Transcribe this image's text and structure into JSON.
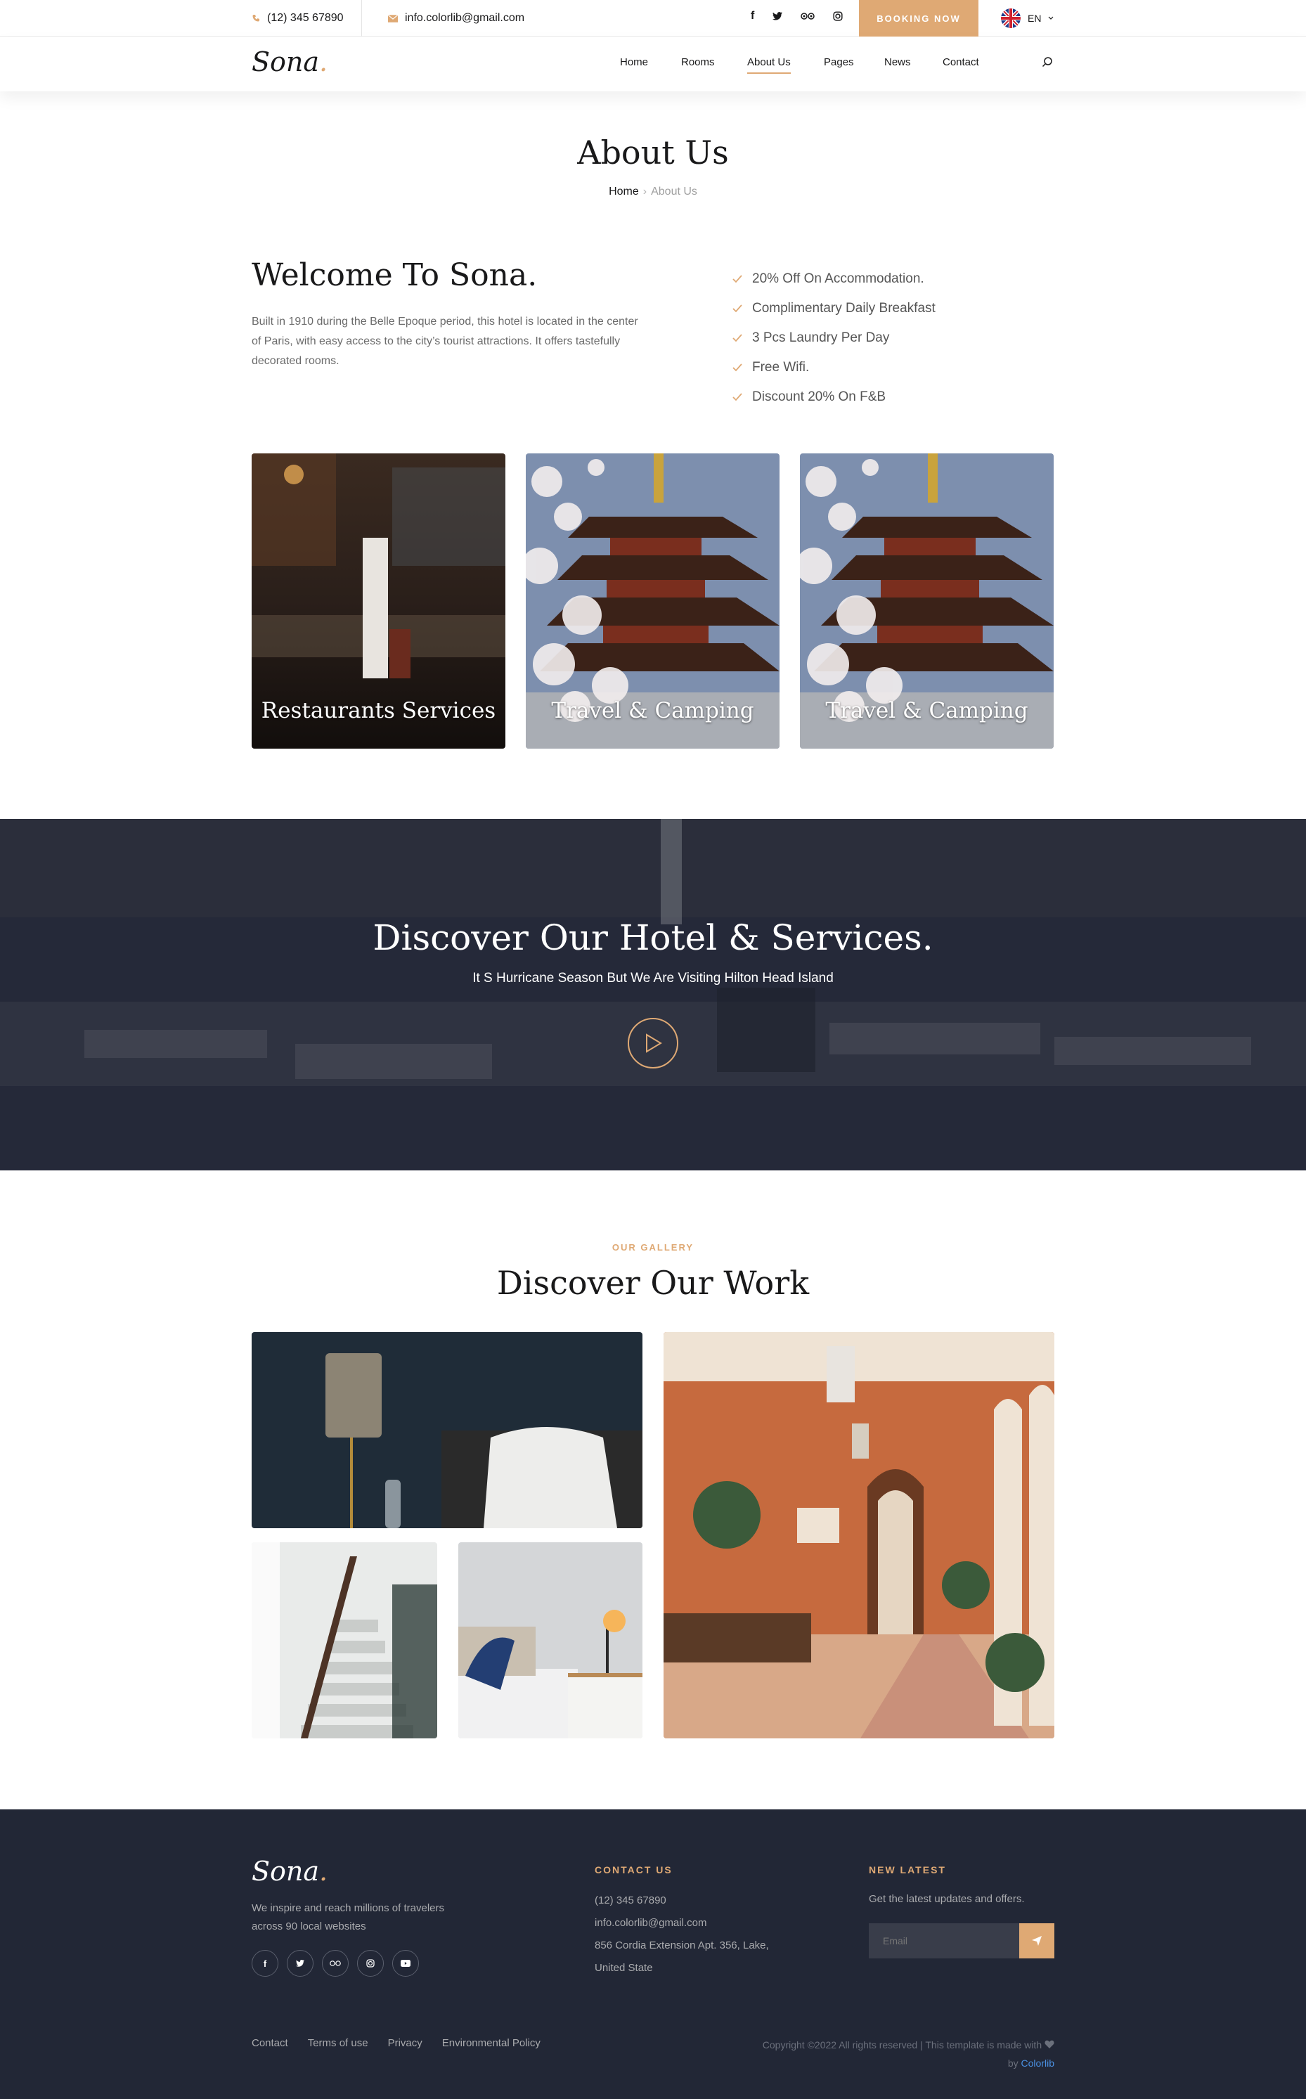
{
  "topbar": {
    "phone": "(12) 345 67890",
    "email": "info.colorlib@gmail.com",
    "booking": "BOOKING NOW",
    "language": "EN"
  },
  "nav": {
    "logo": "Sona",
    "items": [
      "Home",
      "Rooms",
      "About Us",
      "Pages",
      "News",
      "Contact"
    ],
    "active": "About Us"
  },
  "page": {
    "title": "About Us",
    "breadcrumb_home": "Home",
    "breadcrumb_current": "About Us"
  },
  "welcome": {
    "heading": "Welcome To Sona.",
    "text": "Built in 1910 during the Belle Epoque period, this hotel is located in the center of Paris, with easy access to the city’s tourist attractions. It offers tastefully decorated rooms.",
    "features": [
      "20% Off On Accommodation.",
      "Complimentary Daily Breakfast",
      "3 Pcs Laundry Per Day",
      "Free Wifi.",
      "Discount 20% On F&B"
    ]
  },
  "services": [
    "Restaurants Services",
    "Travel & Camping",
    "Travel & Camping"
  ],
  "banner": {
    "heading": "Discover Our Hotel & Services.",
    "subheading": "It S Hurricane Season But We Are Visiting Hilton Head Island"
  },
  "gallery": {
    "eyebrow": "OUR GALLERY",
    "title": "Discover Our Work"
  },
  "footer": {
    "logo": "Sona",
    "about": "We inspire and reach millions of travelers across 90 local websites",
    "contact_heading": "CONTACT US",
    "contact_phone": "(12) 345 67890",
    "contact_email": "info.colorlib@gmail.com",
    "contact_address_1": "856 Cordia Extension Apt. 356, Lake,",
    "contact_address_2": "United State",
    "news_heading": "NEW LATEST",
    "news_text": "Get the latest updates and offers.",
    "email_placeholder": "Email",
    "links": [
      "Contact",
      "Terms of use",
      "Privacy",
      "Environmental Policy"
    ],
    "copyright": "Copyright ©2022 All rights reserved | This template is made with",
    "copyright_by": "by",
    "copyright_brand": "Colorlib"
  },
  "colors": {
    "accent": "#dfa974",
    "footer_bg": "#222736",
    "text": "#19191a"
  }
}
